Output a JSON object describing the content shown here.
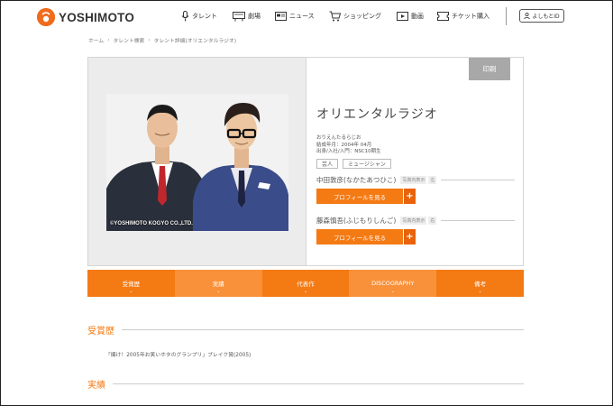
{
  "header": {
    "logo_text": "YOSHIMOTO",
    "nav": [
      {
        "label": "タレント",
        "icon": "mic-icon"
      },
      {
        "label": "劇場",
        "icon": "theater-icon"
      },
      {
        "label": "ニュース",
        "icon": "news-icon"
      },
      {
        "label": "ショッピング",
        "icon": "cart-icon"
      },
      {
        "label": "動画",
        "icon": "video-icon"
      },
      {
        "label": "チケット購入",
        "icon": "ticket-icon"
      }
    ],
    "id_button": "よしもとID"
  },
  "breadcrumb": [
    "ホーム",
    "タレント検索",
    "タレント詳細(オリエンタルラジオ)"
  ],
  "profile": {
    "print_label": "印刷",
    "name": "オリエンタルラジオ",
    "reading": "おりえんたるらじお",
    "formed": "結成年月：2004年 04月",
    "origin": "出身/入社/入門：NSC10期生",
    "tags": [
      "芸人",
      "ミュージシャン"
    ],
    "copyright": "©YOSHIMOTO KOGYO CO.,LTD.",
    "members": [
      {
        "name": "中田敦彦(なかたあつひこ)",
        "photo_label": "写真内表示",
        "position": "左",
        "button": "プロフィールを見る"
      },
      {
        "name": "藤森慎吾(ふじもりしんご)",
        "photo_label": "写真内表示",
        "position": "右",
        "button": "プロフィールを見る"
      }
    ]
  },
  "tabs": [
    "受賞歴",
    "実績",
    "代表作",
    "DISCOGRAPHY",
    "備考"
  ],
  "sections": {
    "awards_title": "受賞歴",
    "award_1": "「爆け！2005年お笑いホタのグランプリ」ブレイク賞(2005)",
    "results_title": "実績"
  },
  "colors": {
    "accent": "#f47a14",
    "accent_light": "#f8913a",
    "logo": "#f06b1c"
  }
}
